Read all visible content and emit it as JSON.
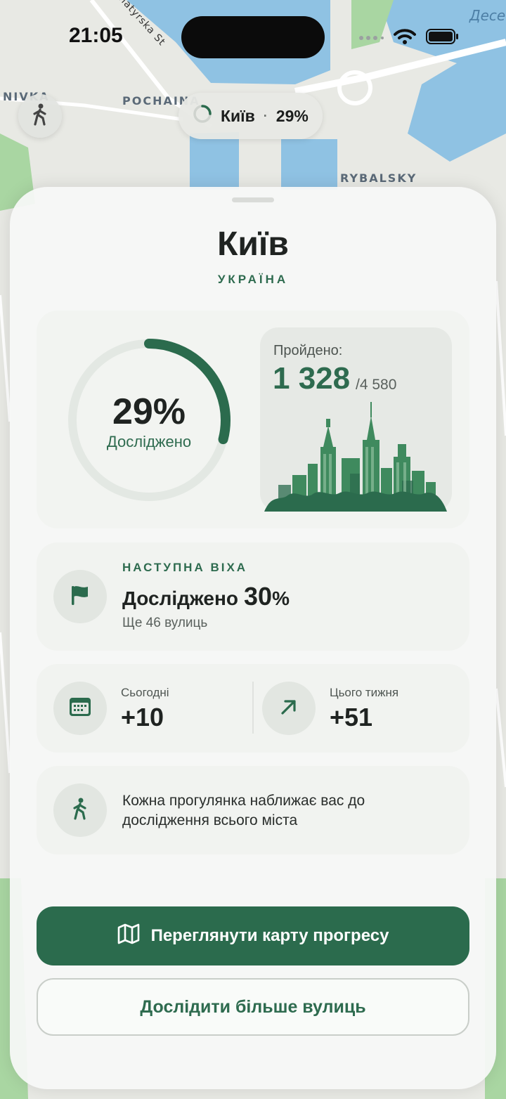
{
  "status_bar": {
    "time": "21:05"
  },
  "map": {
    "labels": {
      "street": "Bohatyrska St",
      "district_1": "POCHAINA",
      "district_2": "RYBALSKY",
      "district_3": "NIVKA",
      "water_label": "Десе"
    }
  },
  "top_pill": {
    "city": "Київ",
    "separator": "·",
    "percent": "29%"
  },
  "sheet": {
    "title": "Київ",
    "subtitle": "УКРАЇНА",
    "progress": {
      "percent_text": "29%",
      "percent_value": 29,
      "label": "Досліджено",
      "walked_label": "Пройдено:",
      "walked_count": "1 328",
      "walked_total": "/4 580"
    },
    "milestone": {
      "kicker": "НАСТУПНА ВІХА",
      "title_prefix": "Досліджено",
      "title_number": "30",
      "title_suffix": "%",
      "subtitle": "Ще 46 вулиць"
    },
    "stats": {
      "today_label": "Сьогодні",
      "today_value": "+10",
      "week_label": "Цього тижня",
      "week_value": "+51"
    },
    "tip": {
      "text": "Кожна прогулянка наближає вас до дослідження всього міста"
    },
    "buttons": {
      "primary": "Переглянути карту прогресу",
      "secondary": "Дослідити більше вулиць"
    }
  },
  "colors": {
    "accent": "#2b6b4d",
    "accent_text": "#2e6b4f",
    "ring_track": "#e3e8e3"
  }
}
